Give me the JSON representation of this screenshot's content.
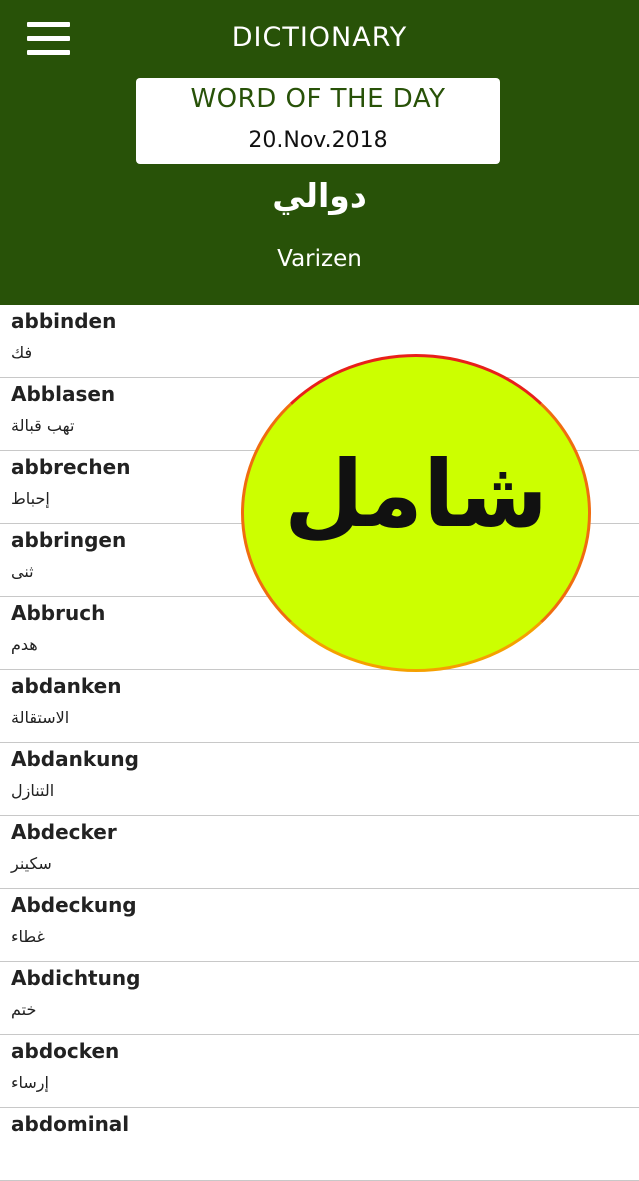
{
  "header": {
    "title": "DICTIONARY",
    "menu_icon": "hamburger-menu-icon"
  },
  "word_of_the_day": {
    "heading": "WORD OF THE DAY",
    "date": "20.Nov.2018",
    "arabic": "دوالي",
    "german": "Varizen"
  },
  "words": [
    {
      "de": "abbinden",
      "ar": "فك"
    },
    {
      "de": "Abblasen",
      "ar": "تهب قبالة"
    },
    {
      "de": "abbrechen",
      "ar": "إحباط"
    },
    {
      "de": "abbringen",
      "ar": "ثنى"
    },
    {
      "de": "Abbruch",
      "ar": "هدم"
    },
    {
      "de": "abdanken",
      "ar": "الاستقالة"
    },
    {
      "de": "Abdankung",
      "ar": "التنازل"
    },
    {
      "de": "Abdecker",
      "ar": "سكينر"
    },
    {
      "de": "Abdeckung",
      "ar": "غطاء"
    },
    {
      "de": "Abdichtung",
      "ar": "ختم"
    },
    {
      "de": "abdocken",
      "ar": "إرساء"
    },
    {
      "de": "abdominal",
      "ar": ""
    }
  ],
  "badge": {
    "text": "شامل"
  },
  "colors": {
    "primary": "#285208",
    "badge_fill": "#ccff00",
    "badge_ring": "#e8201a"
  }
}
